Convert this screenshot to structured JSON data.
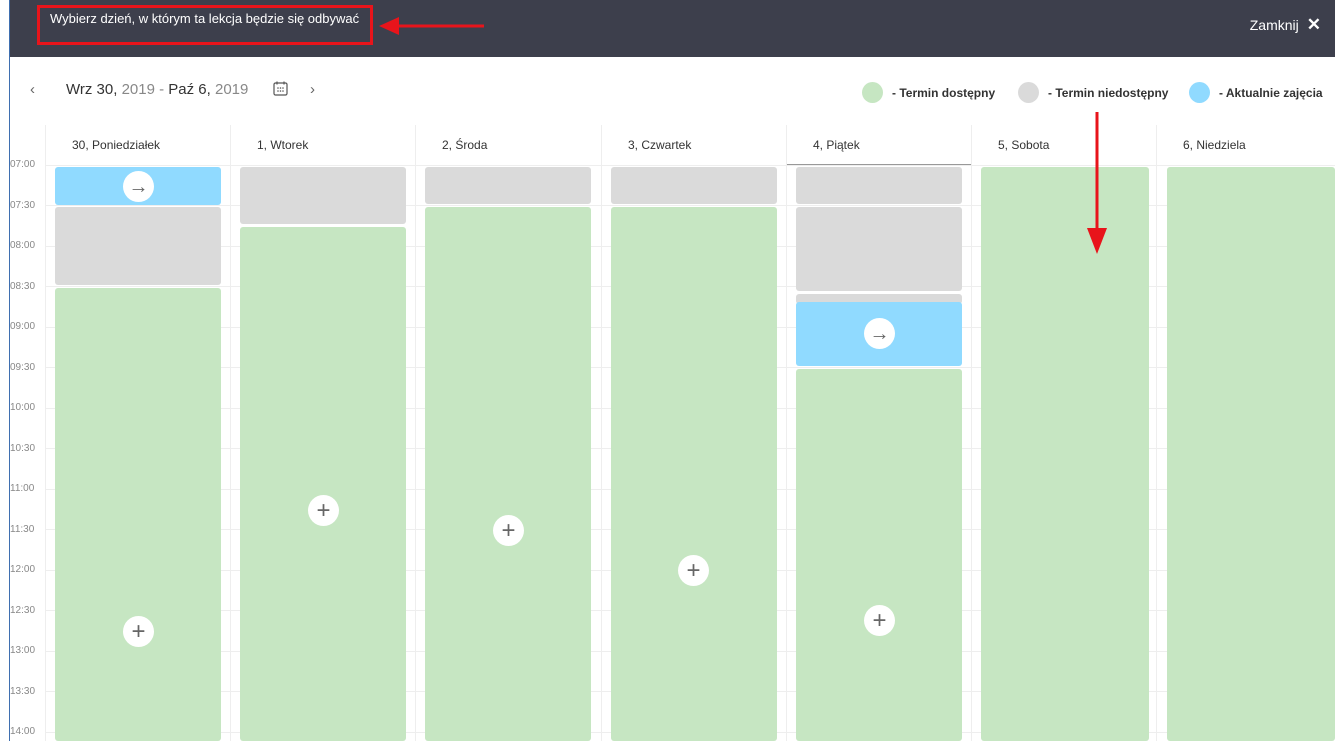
{
  "header": {
    "title": "Wybierz dzień, w którym ta lekcja będzie się odbywać",
    "close_label": "Zamknij",
    "close_glyph": "✕"
  },
  "toolbar": {
    "prev_glyph": "‹",
    "next_glyph": "›",
    "range_start": "Wrz 30,",
    "range_start_year": "2019",
    "range_sep": "-",
    "range_end": "Paź 6,",
    "range_end_year": "2019"
  },
  "legend": [
    {
      "label": "- Termin dostępny",
      "color": "#c6e6c2"
    },
    {
      "label": "- Termin niedostępny",
      "color": "#dadada"
    },
    {
      "label": "- Aktualnie zajęcia",
      "color": "#90daff"
    }
  ],
  "days": [
    {
      "label": "30, Poniedziałek"
    },
    {
      "label": "1, Wtorek"
    },
    {
      "label": "2, Środa"
    },
    {
      "label": "3, Czwartek"
    },
    {
      "label": "4, Piątek"
    },
    {
      "label": "5, Sobota"
    },
    {
      "label": "6, Niedziela"
    }
  ],
  "hours": [
    "07:00",
    "07:30",
    "08:00",
    "08:30",
    "09:00",
    "09:30",
    "10:00",
    "10:30",
    "11:00",
    "11:30",
    "12:00",
    "12:30",
    "13:00",
    "13:30",
    "14:00"
  ],
  "colors": {
    "available": "#c6e6c2",
    "unavailable": "#dadada",
    "current": "#90daff",
    "header_bg": "#3d3f4c",
    "annotation": "#e8141b"
  },
  "icons": {
    "add": "+",
    "move": "→"
  }
}
